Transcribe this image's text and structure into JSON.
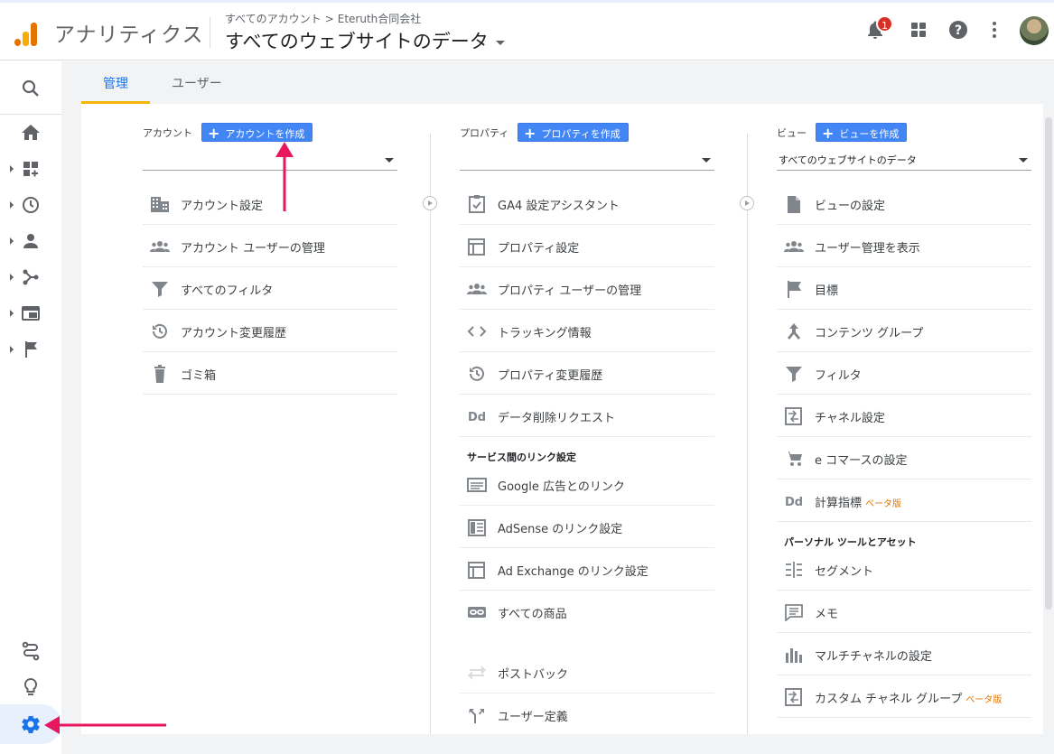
{
  "header": {
    "app_name": "アナリティクス",
    "breadcrumb": {
      "root": "すべてのアカウント",
      "separator": ">",
      "account": "Eteruth合同会社"
    },
    "view_title": "すべてのウェブサイトのデータ",
    "notification_count": "1"
  },
  "tabs": {
    "admin": "管理",
    "user": "ユーザー"
  },
  "account_column": {
    "label": "アカウント",
    "create_button": "アカウントを作成",
    "selected": "",
    "items": [
      {
        "label": "アカウント設定",
        "icon": "building-icon"
      },
      {
        "label": "アカウント ユーザーの管理",
        "icon": "people-icon"
      },
      {
        "label": "すべてのフィルタ",
        "icon": "filter-icon"
      },
      {
        "label": "アカウント変更履歴",
        "icon": "history-icon"
      },
      {
        "label": "ゴミ箱",
        "icon": "trash-icon"
      }
    ]
  },
  "property_column": {
    "label": "プロパティ",
    "create_button": "プロパティを作成",
    "selected": "",
    "items": [
      {
        "label": "GA4 設定アシスタント",
        "icon": "checklist-icon"
      },
      {
        "label": "プロパティ設定",
        "icon": "layout-icon"
      },
      {
        "label": "プロパティ ユーザーの管理",
        "icon": "people-icon"
      },
      {
        "label": "トラッキング情報",
        "icon": "code-icon"
      },
      {
        "label": "プロパティ変更履歴",
        "icon": "history-icon"
      },
      {
        "label": "データ削除リクエスト",
        "icon": "dd-icon"
      }
    ],
    "link_section_title": "サービス間のリンク設定",
    "link_items": [
      {
        "label": "Google 広告とのリンク",
        "icon": "ads-icon"
      },
      {
        "label": "AdSense のリンク設定",
        "icon": "adsense-icon"
      },
      {
        "label": "Ad Exchange のリンク設定",
        "icon": "adexchange-icon"
      },
      {
        "label": "すべての商品",
        "icon": "link-icon"
      },
      {
        "label": "ポストバック",
        "icon": "postback-icon"
      },
      {
        "label": "ユーザー定義",
        "icon": "fork-icon"
      }
    ]
  },
  "view_column": {
    "label": "ビュー",
    "create_button": "ビューを作成",
    "selected": "すべてのウェブサイトのデータ",
    "items": [
      {
        "label": "ビューの設定",
        "icon": "document-icon"
      },
      {
        "label": "ユーザー管理を表示",
        "icon": "people-icon"
      },
      {
        "label": "目標",
        "icon": "flag-icon"
      },
      {
        "label": "コンテンツ グループ",
        "icon": "merge-icon"
      },
      {
        "label": "フィルタ",
        "icon": "filter-icon"
      },
      {
        "label": "チャネル設定",
        "icon": "channel-icon"
      },
      {
        "label": "e コマースの設定",
        "icon": "cart-icon"
      },
      {
        "label": "計算指標",
        "icon": "dd-icon",
        "beta": "ベータ版"
      }
    ],
    "personal_section_title": "パーソナル ツールとアセット",
    "personal_items": [
      {
        "label": "セグメント",
        "icon": "segment-icon"
      },
      {
        "label": "メモ",
        "icon": "comment-icon"
      },
      {
        "label": "マルチチャネルの設定",
        "icon": "bars-icon"
      },
      {
        "label": "カスタム チャネル グループ",
        "icon": "channel-icon",
        "beta": "ベータ版"
      }
    ]
  },
  "colors": {
    "accent": "#1a73e8",
    "create_button": "#4285f4",
    "tab_underline": "#f4b400",
    "annotation_arrow": "#e8175d"
  }
}
